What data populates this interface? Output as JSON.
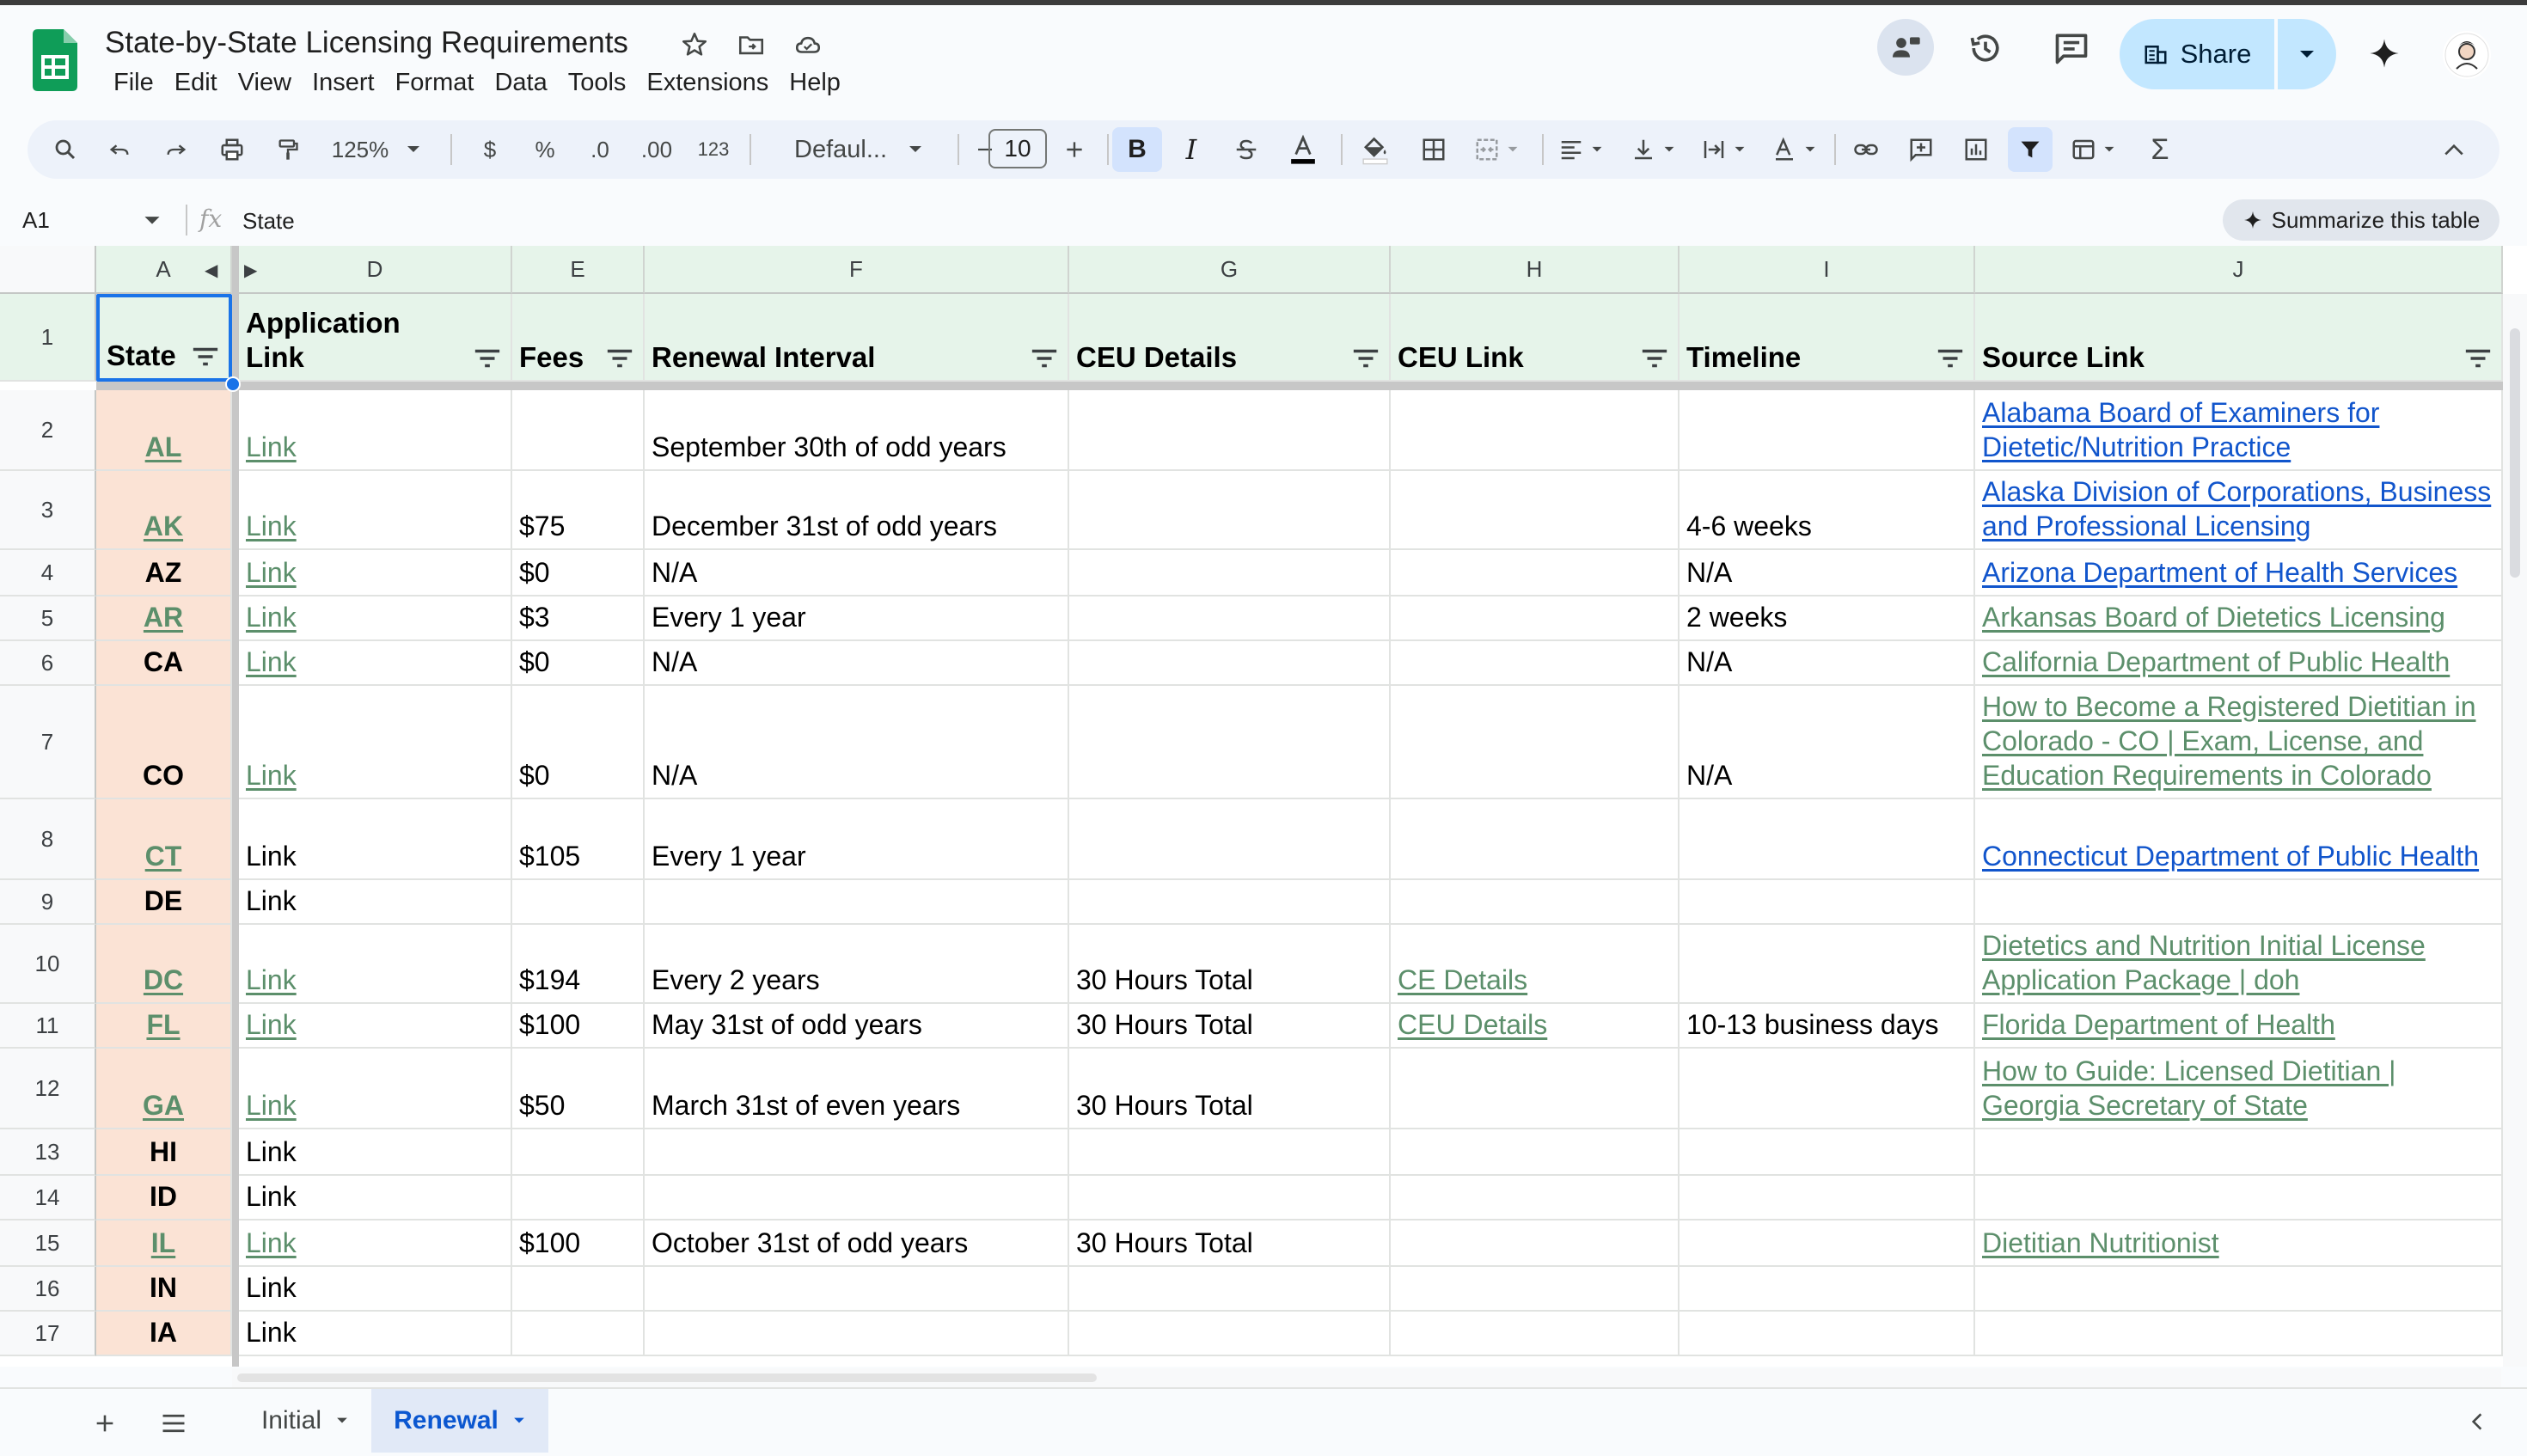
{
  "document": {
    "title": "State-by-State Licensing Requirements"
  },
  "menu": [
    "File",
    "Edit",
    "View",
    "Insert",
    "Format",
    "Data",
    "Tools",
    "Extensions",
    "Help"
  ],
  "header": {
    "share_label": "Share"
  },
  "toolbar": {
    "zoom": "125%",
    "currency": "$",
    "percent": "%",
    "dec_decrease": ".0",
    "dec_increase": ".00",
    "number_format": "123",
    "font": "Defaul...",
    "font_size": "10"
  },
  "formula_bar": {
    "cell_ref": "A1",
    "content": "State",
    "summarize_label": "Summarize this table"
  },
  "columns": [
    "A",
    "D",
    "E",
    "F",
    "G",
    "H",
    "I",
    "J"
  ],
  "headers": {
    "A": "State",
    "D_line1": "Application",
    "D_line2": "Link",
    "E": "Fees",
    "F": "Renewal Interval",
    "G": "CEU Details",
    "H": "CEU Link",
    "I": "Timeline",
    "J": "Source Link"
  },
  "rows": [
    {
      "num": "2",
      "state": "AL",
      "app": "Link",
      "fee": "",
      "renewal": "September 30th of odd years",
      "ceu": "",
      "ceu_link": "",
      "timeline": "",
      "source": "Alabama Board of Examiners for Dietetic/Nutrition Practice"
    },
    {
      "num": "3",
      "state": "AK",
      "app": "Link",
      "fee": "$75",
      "renewal": "December 31st of odd years",
      "ceu": "",
      "ceu_link": "",
      "timeline": "4-6 weeks",
      "source": "Alaska Division of Corporations, Business and Professional Licensing"
    },
    {
      "num": "4",
      "state": "AZ",
      "app": "Link",
      "fee": "$0",
      "renewal": "N/A",
      "ceu": "",
      "ceu_link": "",
      "timeline": "N/A",
      "source": "Arizona Department of Health Services"
    },
    {
      "num": "5",
      "state": "AR",
      "app": "Link",
      "fee": "$3",
      "renewal": "Every 1 year",
      "ceu": "",
      "ceu_link": "",
      "timeline": "2 weeks",
      "source": "Arkansas Board of Dietetics Licensing"
    },
    {
      "num": "6",
      "state": "CA",
      "app": "Link",
      "fee": "$0",
      "renewal": "N/A",
      "ceu": "",
      "ceu_link": "",
      "timeline": "N/A",
      "source": "California Department of Public Health"
    },
    {
      "num": "7",
      "state": "CO",
      "app": "Link",
      "fee": "$0",
      "renewal": "N/A",
      "ceu": "",
      "ceu_link": "",
      "timeline": "N/A",
      "source": "How to Become a Registered Dietitian in Colorado - CO | Exam, License, and Education Requirements in Colorado"
    },
    {
      "num": "8",
      "state": "CT",
      "app": "Link",
      "fee": "$105",
      "renewal": "Every 1 year",
      "ceu": "",
      "ceu_link": "",
      "timeline": "",
      "source": "Connecticut Department of Public Health"
    },
    {
      "num": "9",
      "state": "DE",
      "app": "Link",
      "fee": "",
      "renewal": "",
      "ceu": "",
      "ceu_link": "",
      "timeline": "",
      "source": ""
    },
    {
      "num": "10",
      "state": "DC",
      "app": "Link",
      "fee": "$194",
      "renewal": "Every 2 years",
      "ceu": "30 Hours Total",
      "ceu_link": "CE Details",
      "timeline": "",
      "source": "Dietetics and Nutrition Initial License Application Package | doh"
    },
    {
      "num": "11",
      "state": "FL",
      "app": "Link",
      "fee": "$100",
      "renewal": "May 31st of odd years",
      "ceu": "30 Hours Total",
      "ceu_link": "CEU Details",
      "timeline": "10-13 business days",
      "source": "Florida Department of Health"
    },
    {
      "num": "12",
      "state": "GA",
      "app": "Link",
      "fee": "$50",
      "renewal": "March 31st of even years",
      "ceu": "30 Hours Total",
      "ceu_link": "",
      "timeline": "",
      "source": "How to Guide: Licensed Dietitian | Georgia Secretary of State"
    },
    {
      "num": "13",
      "state": "HI",
      "app": "Link",
      "fee": "",
      "renewal": "",
      "ceu": "",
      "ceu_link": "",
      "timeline": "",
      "source": ""
    },
    {
      "num": "14",
      "state": "ID",
      "app": "Link",
      "fee": "",
      "renewal": "",
      "ceu": "",
      "ceu_link": "",
      "timeline": "",
      "source": ""
    },
    {
      "num": "15",
      "state": "IL",
      "app": "Link",
      "fee": "$100",
      "renewal": "October 31st of odd years",
      "ceu": "30 Hours Total",
      "ceu_link": "",
      "timeline": "",
      "source": "Dietitian Nutritionist"
    },
    {
      "num": "16",
      "state": "IN",
      "app": "Link",
      "fee": "",
      "renewal": "",
      "ceu": "",
      "ceu_link": "",
      "timeline": "",
      "source": ""
    },
    {
      "num": "17",
      "state": "IA",
      "app": "Link",
      "fee": "",
      "renewal": "",
      "ceu": "",
      "ceu_link": "",
      "timeline": "",
      "source": ""
    }
  ],
  "row_header_1": "1",
  "sheets": {
    "initial": "Initial",
    "renewal": "Renewal"
  },
  "colors": {
    "header_green": "#e6f4ea",
    "state_fill": "#fbe3d5",
    "link_green": "#5c8f6b",
    "link_blue": "#1155cc",
    "share_bg": "#c2e7ff"
  }
}
